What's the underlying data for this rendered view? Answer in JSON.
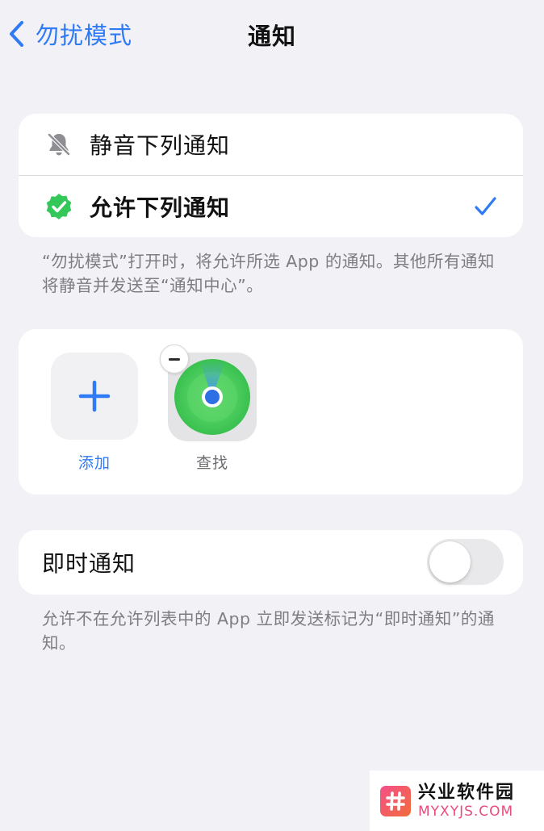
{
  "nav": {
    "back_label": "勿扰模式",
    "title": "通知"
  },
  "options": {
    "silence_label": "静音下列通知",
    "allow_label": "允许下列通知",
    "selected": "allow"
  },
  "footnote_options": "“勿扰模式”打开时，将允许所选 App 的通知。其他所有通知将静音并发送至“通知中心”。",
  "apps": {
    "add_label": "添加",
    "items": [
      {
        "name": "查找",
        "icon": "find-my-icon"
      }
    ]
  },
  "timely": {
    "label": "即时通知",
    "enabled": false
  },
  "footnote_timely": "允许不在允许列表中的 App 立即发送标记为“即时通知”的通知。",
  "watermark": {
    "name": "兴业软件园",
    "site": "MYXYJS.COM"
  },
  "colors": {
    "accent": "#2f7bf6",
    "background": "#f2f1f6",
    "allow_icon": "#34c759",
    "footnote": "#7d7d82"
  }
}
